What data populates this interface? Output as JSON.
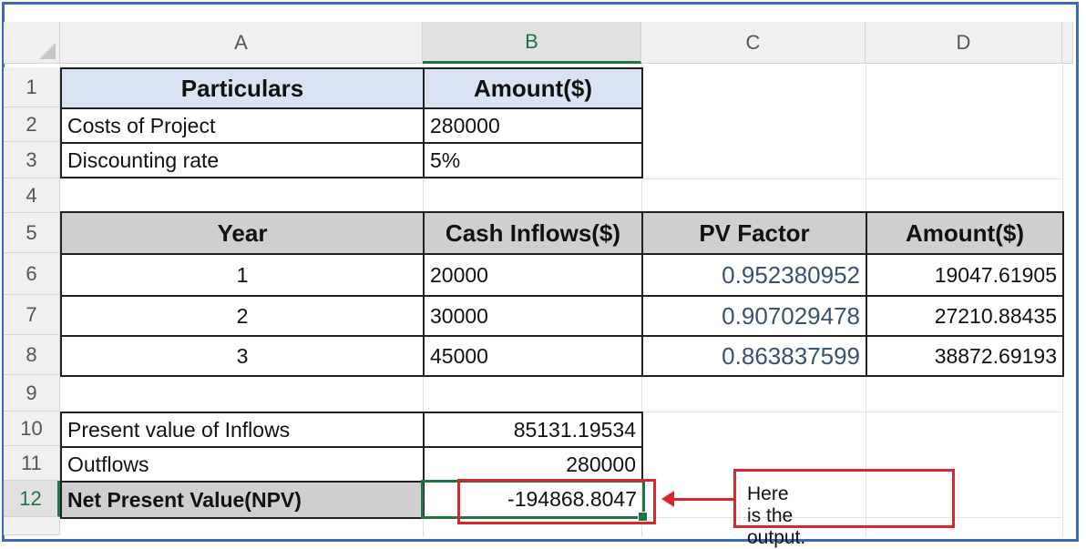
{
  "columns": [
    "A",
    "B",
    "C",
    "D"
  ],
  "selected_column": "B",
  "rows": [
    "1",
    "2",
    "3",
    "4",
    "5",
    "6",
    "7",
    "8",
    "9",
    "10",
    "11",
    "12"
  ],
  "selected_row": "12",
  "cells": {
    "a1": "Particulars",
    "b1": "Amount($)",
    "a2": "Costs of Project",
    "b2": "280000",
    "a3": "Discounting rate",
    "b3": "5%",
    "a5": "Year",
    "b5": "Cash Inflows($)",
    "c5": "PV Factor",
    "d5": "Amount($)",
    "a6": "1",
    "b6": "20000",
    "c6": "0.952380952",
    "d6": "19047.61905",
    "a7": "2",
    "b7": "30000",
    "c7": "0.907029478",
    "d7": "27210.88435",
    "a8": "3",
    "b8": "45000",
    "c8": "0.863837599",
    "d8": "38872.69193",
    "a10": "Present value of Inflows",
    "b10": "85131.19534",
    "a11": "Outflows",
    "b11": "280000",
    "a12": "Net Present Value(NPV)",
    "b12": "-194868.8047"
  },
  "callout": {
    "text": "Here is  the output."
  },
  "colors": {
    "frame": "#3e6bb4",
    "header_fill_1": "#dae3f3",
    "header_fill_5": "#d0cece",
    "excel_green": "#217346",
    "callout_red": "#d8282f",
    "pv_factor_text": "#3a5171"
  }
}
